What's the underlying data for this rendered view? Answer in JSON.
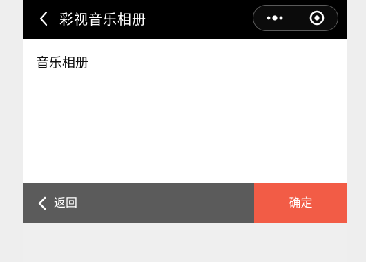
{
  "navbar": {
    "back_icon": "chevron-left-icon",
    "title": "彩视音乐相册",
    "more_icon": "more-dots-icon",
    "close_icon": "target-close-icon"
  },
  "content": {
    "title": "音乐相册"
  },
  "bottom_bar": {
    "back_label": "返回",
    "back_icon": "chevron-left-icon",
    "confirm_label": "确定"
  },
  "colors": {
    "navbar_bg": "#000000",
    "back_button_bg": "#5b5b5b",
    "confirm_button_bg": "#f25c46",
    "page_bg": "#eeeeee"
  }
}
